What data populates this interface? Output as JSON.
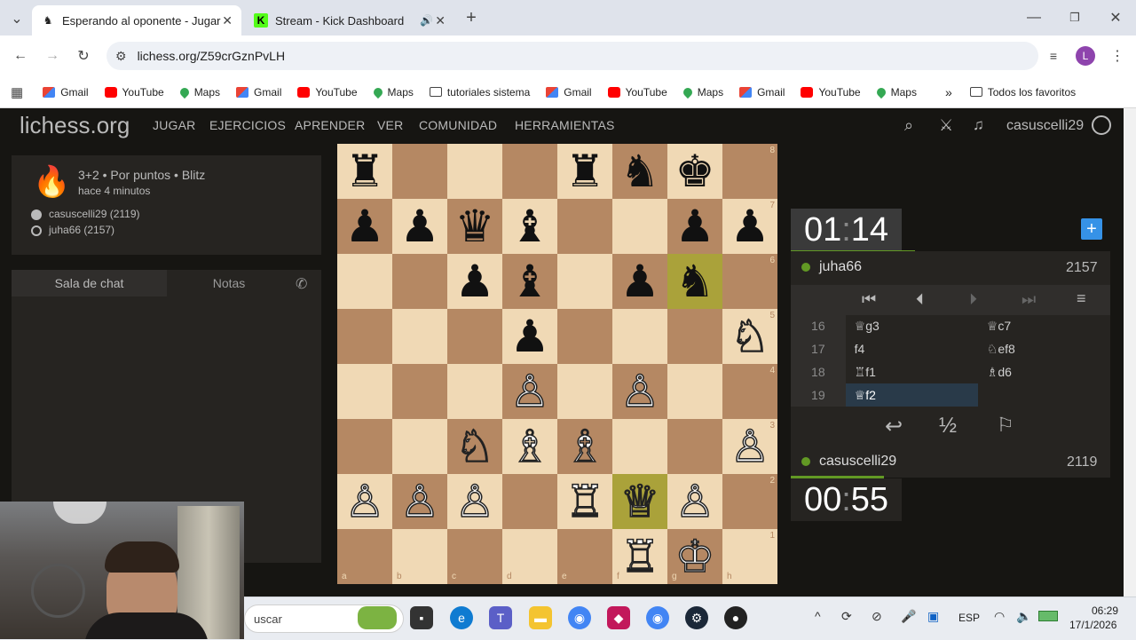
{
  "browser": {
    "tabs": [
      {
        "title": "Esperando al oponente - Jugar",
        "active": true
      },
      {
        "title": "Stream - Kick Dashboard",
        "active": false
      }
    ],
    "url": "lichess.org/Z59crGznPvLH",
    "bookmarks": [
      "Gmail",
      "YouTube",
      "Maps",
      "Gmail",
      "YouTube",
      "Maps",
      "tutoriales sistema",
      "Gmail",
      "YouTube",
      "Maps",
      "Gmail",
      "YouTube",
      "Maps"
    ],
    "all_bookmarks": "Todos los favoritos",
    "profile_initial": "L"
  },
  "site": {
    "logo": "lichess.org",
    "nav": [
      "JUGAR",
      "EJERCICIOS",
      "APRENDER",
      "VER",
      "COMUNIDAD",
      "HERRAMIENTAS"
    ],
    "username": "casuscelli29"
  },
  "game": {
    "mode": "3+2 • Por puntos • Blitz",
    "time_ago": "hace 4 minutos",
    "white_player": "casuscelli29 (2119)",
    "black_player": "juha66 (2157)"
  },
  "chat": {
    "tab_chat": "Sala de chat",
    "tab_notes": "Notas"
  },
  "board": {
    "ranks": [
      [
        "♜",
        "",
        "",
        "",
        "♜",
        "♞",
        "♚",
        ""
      ],
      [
        "♟",
        "♟",
        "♛",
        "♝",
        "",
        "",
        "♟",
        "♟"
      ],
      [
        "",
        "",
        "♟",
        "♝",
        "",
        "♟",
        "♞",
        ""
      ],
      [
        "",
        "",
        "",
        "♟",
        "",
        "",
        "",
        "♘"
      ],
      [
        "",
        "",
        "",
        "♙",
        "",
        "♙",
        "",
        ""
      ],
      [
        "",
        "",
        "♘",
        "♗",
        "♗",
        "",
        "",
        "♙"
      ],
      [
        "♙",
        "♙",
        "♙",
        "",
        "♖",
        "♕",
        "♙",
        ""
      ],
      [
        "",
        "",
        "",
        "",
        "",
        "♖",
        "♔",
        ""
      ]
    ],
    "rank_labels": [
      "8",
      "7",
      "6",
      "5",
      "4",
      "3",
      "2",
      "1"
    ],
    "file_labels": [
      "a",
      "b",
      "c",
      "d",
      "e",
      "f",
      "g",
      "h"
    ]
  },
  "clocks": {
    "top": {
      "min": "01",
      "sec": "14",
      "player": "juha66",
      "rating": "2157"
    },
    "bottom": {
      "min": "00",
      "sec": "55",
      "player": "casuscelli29",
      "rating": "2119"
    }
  },
  "moves": [
    {
      "no": "16",
      "white": "♕g3",
      "black": "♕c7"
    },
    {
      "no": "17",
      "white": "f4",
      "black": "♘ef8"
    },
    {
      "no": "18",
      "white": "♖f1",
      "black": "♗d6"
    },
    {
      "no": "19",
      "white": "♕f2",
      "black": ""
    }
  ],
  "controls": {
    "draw": "½"
  },
  "taskbar": {
    "search": "uscar",
    "lang": "ESP",
    "time": "06:29",
    "date": "17/1/2026"
  }
}
